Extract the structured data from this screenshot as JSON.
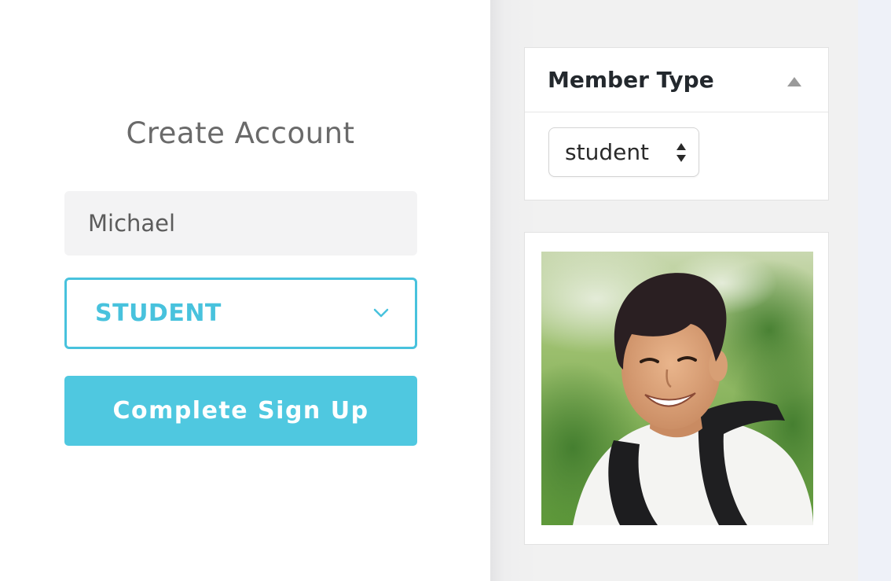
{
  "signup_form": {
    "title": "Create Account",
    "name_value": "Michael",
    "role_value": "STUDENT",
    "submit_label": "Complete Sign Up"
  },
  "member_type_panel": {
    "title": "Member Type",
    "selected_value": "student"
  },
  "icons": {
    "role_dropdown": "chevron-down-icon",
    "collapse": "triangle-up-icon",
    "select_arrows": "updown-arrows-icon"
  },
  "colors": {
    "accent": "#48c2dd",
    "button": "#4fc8e0",
    "title_text": "#6a6a6a",
    "panel_background": "#f1f1f1"
  }
}
